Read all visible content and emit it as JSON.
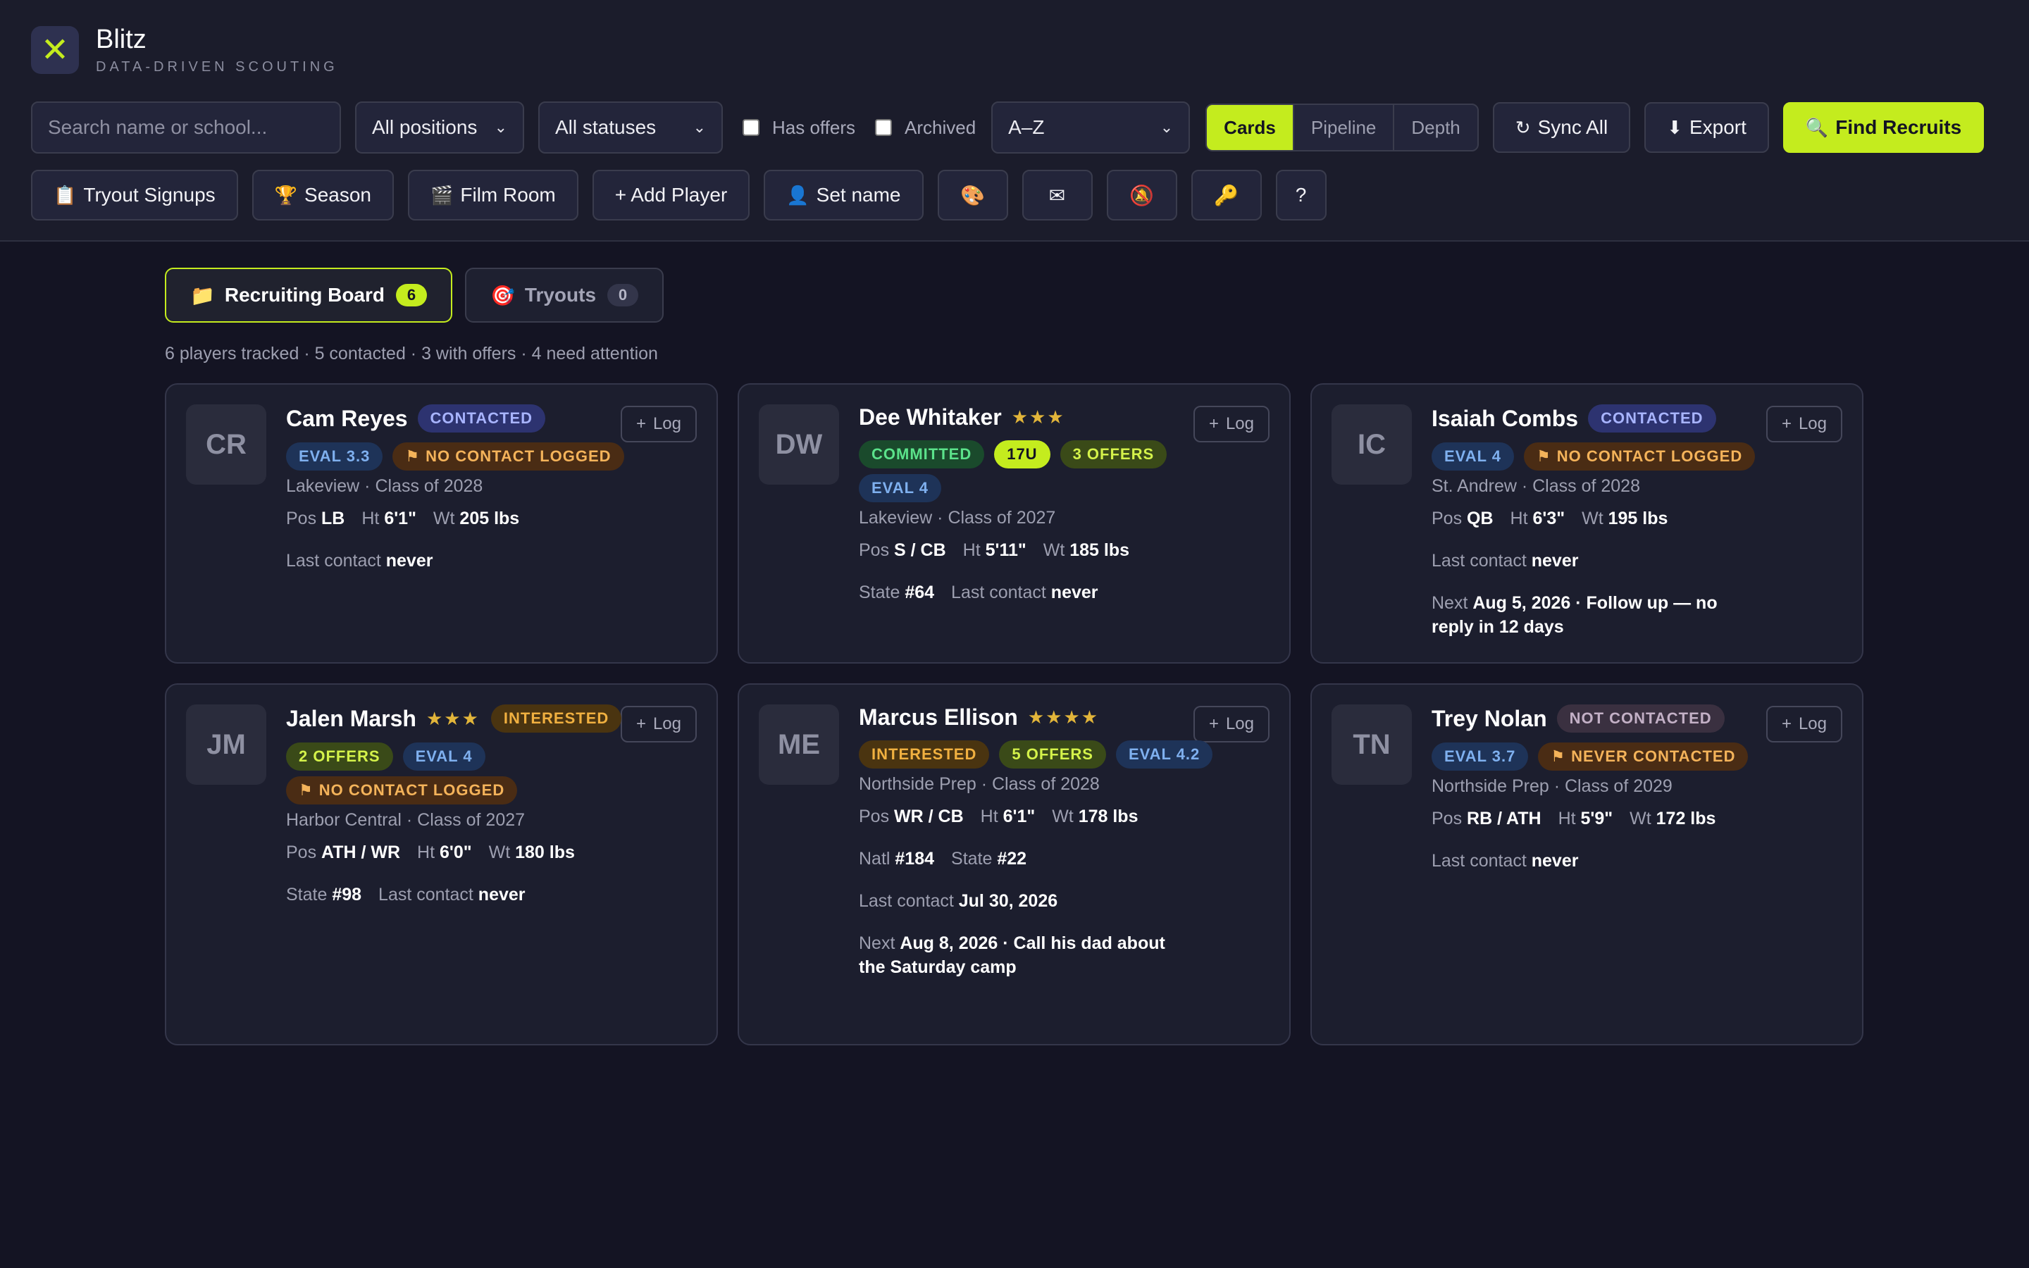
{
  "brand": {
    "name": "Blitz",
    "tagline": "DATA-DRIVEN SCOUTING",
    "logo_glyph": "✕"
  },
  "toolbar": {
    "search_placeholder": "Search name or school...",
    "positions_select": "All positions",
    "statuses_select": "All statuses",
    "has_offers_label": "Has offers",
    "archived_label": "Archived",
    "sort_select": "A–Z",
    "views": [
      "Cards",
      "Pipeline",
      "Depth"
    ],
    "active_view": "Cards",
    "sync_label": "Sync All",
    "sync_icon": "↻",
    "export_label": "Export",
    "export_icon": "⬇",
    "find_label": "Find Recruits",
    "find_icon": "🔍"
  },
  "toolbar2": {
    "tryout_label": "Tryout Signups",
    "tryout_icon": "📋",
    "season_label": "Season",
    "season_icon": "🏆",
    "film_label": "Film Room",
    "film_icon": "🎬",
    "add_label": "+ Add Player",
    "setname_label": "Set name",
    "setname_icon": "👤",
    "palette_icon": "🎨",
    "mail_icon": "✉",
    "bell_icon": "🔕",
    "key_icon": "🔑",
    "help_label": "?"
  },
  "tabs": [
    {
      "label": "Recruiting Board",
      "count": "6",
      "icon": "📁",
      "active": true
    },
    {
      "label": "Tryouts",
      "count": "0",
      "icon": "🎯",
      "active": false
    }
  ],
  "summary": "6 players tracked · 5 contacted · 3 with offers · 4 need attention",
  "log_label": "Log",
  "players": [
    {
      "initials": "CR",
      "name": "Cam Reyes",
      "stars": "",
      "status": "CONTACTED",
      "status_class": "b-contacted",
      "badges": [
        {
          "text": "EVAL 3.3",
          "cls": "b-eval"
        },
        {
          "text": "NO CONTACT LOGGED",
          "cls": "b-warn",
          "flag": true
        }
      ],
      "school": "Lakeview · Class of 2028",
      "pos": "LB",
      "ht": "6'1\"",
      "wt": "205 lbs",
      "state_rank": "",
      "natl_rank": "",
      "last_contact": "never",
      "next": ""
    },
    {
      "initials": "DW",
      "name": "Dee Whitaker",
      "stars": "★★★",
      "status": "",
      "status_class": "",
      "badges": [
        {
          "text": "COMMITTED",
          "cls": "b-committed"
        },
        {
          "text": "17U",
          "cls": "b-17u"
        },
        {
          "text": "3 OFFERS",
          "cls": "b-offers"
        },
        {
          "text": "EVAL 4",
          "cls": "b-eval"
        }
      ],
      "school": "Lakeview · Class of 2027",
      "pos": "S / CB",
      "ht": "5'11\"",
      "wt": "185 lbs",
      "state_rank": "#64",
      "natl_rank": "",
      "last_contact": "never",
      "next": ""
    },
    {
      "initials": "IC",
      "name": "Isaiah Combs",
      "stars": "",
      "status": "CONTACTED",
      "status_class": "b-contacted",
      "badges": [
        {
          "text": "EVAL 4",
          "cls": "b-eval"
        },
        {
          "text": "NO CONTACT LOGGED",
          "cls": "b-warn",
          "flag": true
        }
      ],
      "school": "St. Andrew · Class of 2028",
      "pos": "QB",
      "ht": "6'3\"",
      "wt": "195 lbs",
      "state_rank": "",
      "natl_rank": "",
      "last_contact": "never",
      "next": "Aug 5, 2026 · Follow up — no reply in 12 days"
    },
    {
      "initials": "JM",
      "name": "Jalen Marsh",
      "stars": "★★★",
      "status": "INTERESTED",
      "status_class": "b-interested",
      "badges": [
        {
          "text": "2 OFFERS",
          "cls": "b-offers"
        },
        {
          "text": "EVAL 4",
          "cls": "b-eval"
        },
        {
          "text": "NO CONTACT LOGGED",
          "cls": "b-warn",
          "flag": true
        }
      ],
      "school": "Harbor Central · Class of 2027",
      "pos": "ATH / WR",
      "ht": "6'0\"",
      "wt": "180 lbs",
      "state_rank": "#98",
      "natl_rank": "",
      "last_contact": "never",
      "next": ""
    },
    {
      "initials": "ME",
      "name": "Marcus Ellison",
      "stars": "★★★★",
      "status": "",
      "status_class": "",
      "badges": [
        {
          "text": "INTERESTED",
          "cls": "b-interested"
        },
        {
          "text": "5 OFFERS",
          "cls": "b-offers"
        },
        {
          "text": "EVAL 4.2",
          "cls": "b-eval"
        }
      ],
      "school": "Northside Prep · Class of 2028",
      "pos": "WR / CB",
      "ht": "6'1\"",
      "wt": "178 lbs",
      "state_rank": "#22",
      "natl_rank": "#184",
      "last_contact": "Jul 30, 2026",
      "next": "Aug 8, 2026 · Call his dad about the Saturday camp"
    },
    {
      "initials": "TN",
      "name": "Trey Nolan",
      "stars": "",
      "status": "NOT CONTACTED",
      "status_class": "b-notcontacted",
      "badges": [
        {
          "text": "EVAL 3.7",
          "cls": "b-eval"
        },
        {
          "text": "NEVER CONTACTED",
          "cls": "b-warn",
          "flag": true
        }
      ],
      "school": "Northside Prep · Class of 2029",
      "pos": "RB / ATH",
      "ht": "5'9\"",
      "wt": "172 lbs",
      "state_rank": "",
      "natl_rank": "",
      "last_contact": "never",
      "next": ""
    }
  ],
  "labels": {
    "pos": "Pos",
    "ht": "Ht",
    "wt": "Wt",
    "state": "State",
    "natl": "Natl",
    "last_contact": "Last contact",
    "next": "Next"
  },
  "colors": {
    "accent": "#c4ec1e",
    "background": "#141423",
    "header": "#1b1c2b",
    "card": "#1c1e2e"
  }
}
